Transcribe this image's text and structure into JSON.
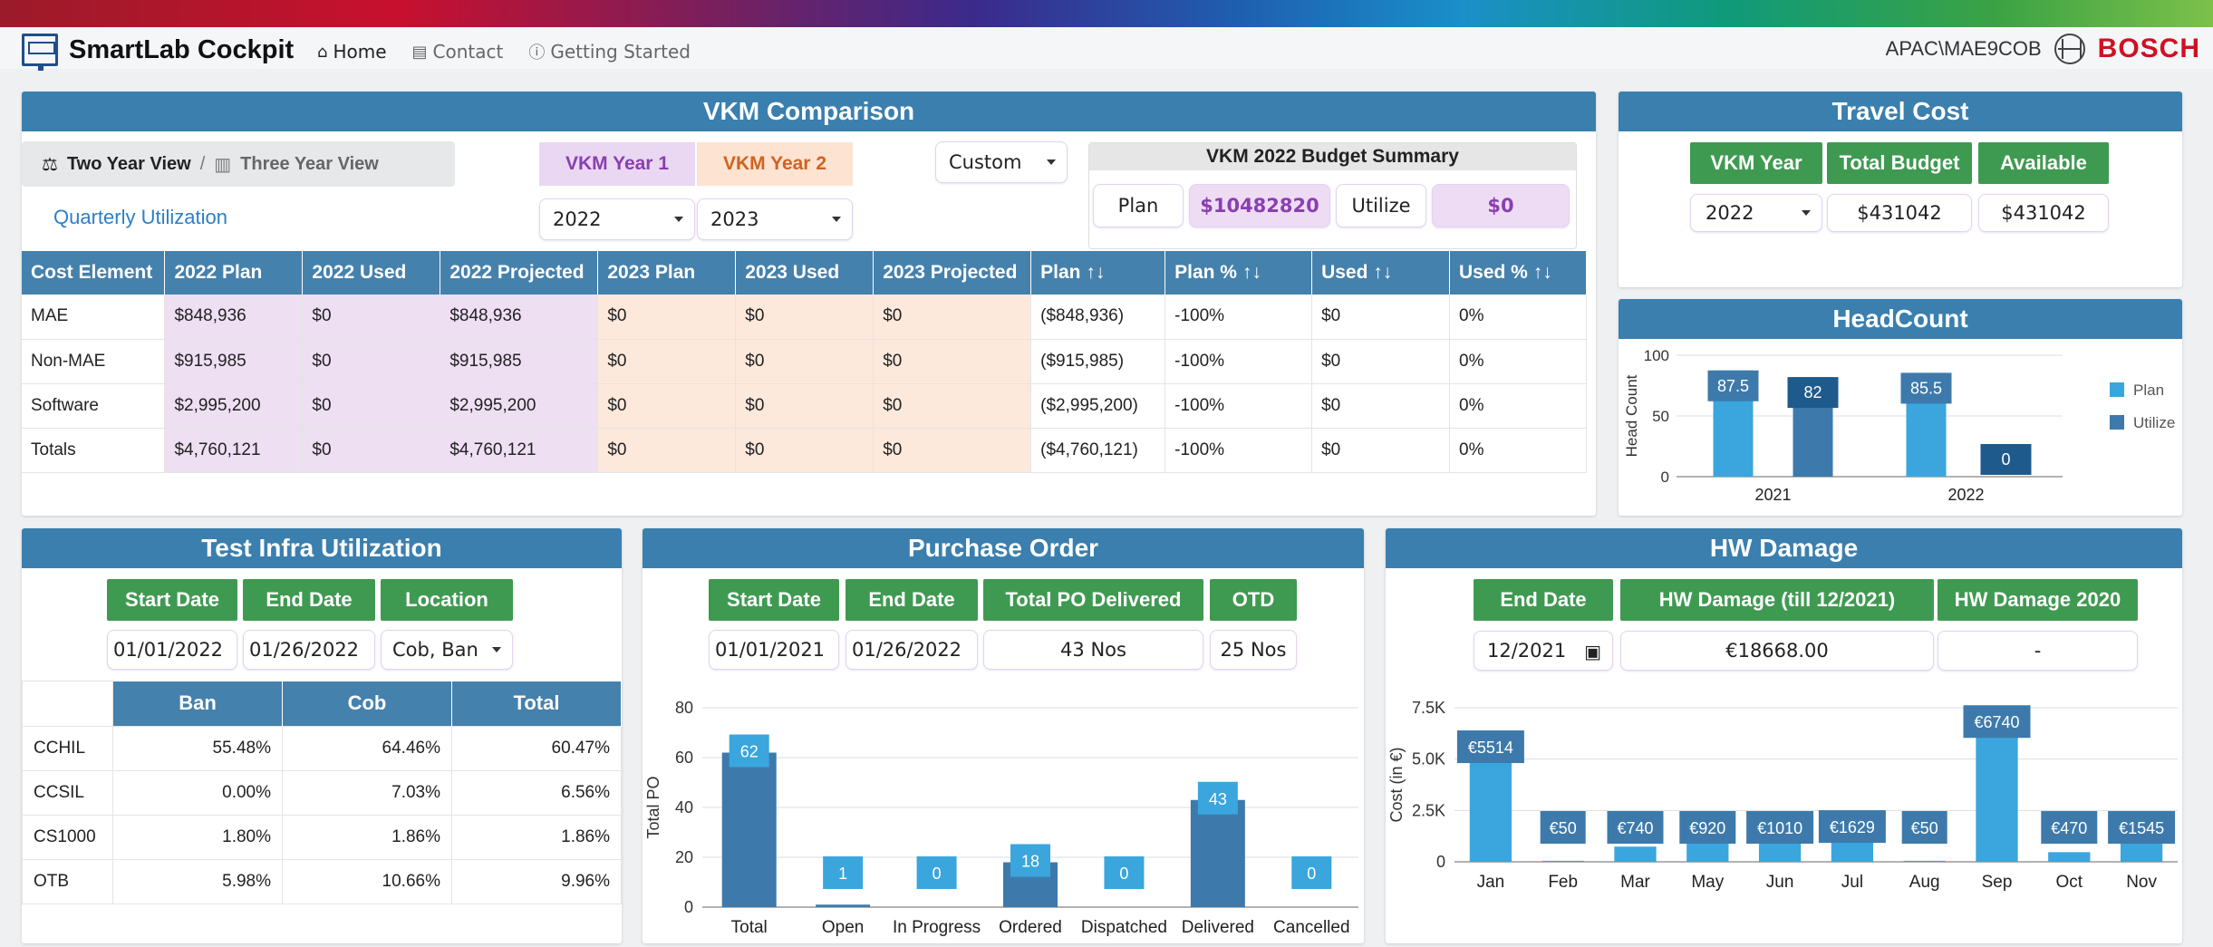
{
  "app": {
    "title": "SmartLab Cockpit",
    "user": "APAC\\MAE9COB",
    "company": "BOSCH"
  },
  "nav": [
    {
      "label": "Home",
      "icon": "home-icon"
    },
    {
      "label": "Contact",
      "icon": "contact-card-icon"
    },
    {
      "label": "Getting Started",
      "icon": "info-circle-icon"
    }
  ],
  "vkm": {
    "title": "VKM Comparison",
    "view_two": "Two Year View",
    "view_sep": "/",
    "view_three": "Three Year View",
    "quarterly_link": "Quarterly Utilization",
    "year1_label": "VKM Year 1",
    "year2_label": "VKM Year 2",
    "year1_value": "2022",
    "year2_value": "2023",
    "custom_value": "Custom",
    "budget": {
      "title": "VKM 2022 Budget Summary",
      "plan_label": "Plan",
      "plan_value": "$10482820",
      "utilize_label": "Utilize",
      "utilize_value": "$0"
    },
    "columns": [
      "Cost Element",
      "2022 Plan",
      "2022 Used",
      "2022 Projected",
      "2023 Plan",
      "2023 Used",
      "2023 Projected",
      "Plan ↑↓",
      "Plan % ↑↓",
      "Used ↑↓",
      "Used % ↑↓"
    ],
    "rows": [
      [
        "MAE",
        "$848,936",
        "$0",
        "$848,936",
        "$0",
        "$0",
        "$0",
        "($848,936)",
        "-100%",
        "$0",
        "0%"
      ],
      [
        "Non-MAE",
        "$915,985",
        "$0",
        "$915,985",
        "$0",
        "$0",
        "$0",
        "($915,985)",
        "-100%",
        "$0",
        "0%"
      ],
      [
        "Software",
        "$2,995,200",
        "$0",
        "$2,995,200",
        "$0",
        "$0",
        "$0",
        "($2,995,200)",
        "-100%",
        "$0",
        "0%"
      ],
      [
        "Totals",
        "$4,760,121",
        "$0",
        "$4,760,121",
        "$0",
        "$0",
        "$0",
        "($4,760,121)",
        "-100%",
        "$0",
        "0%"
      ]
    ]
  },
  "travel": {
    "title": "Travel Cost",
    "year_label": "VKM Year",
    "total_label": "Total Budget",
    "available_label": "Available",
    "year_value": "2022",
    "total_value": "$431042",
    "available_value": "$431042"
  },
  "headcount": {
    "title": "HeadCount",
    "chart_data": {
      "type": "bar",
      "ylabel": "Head Count",
      "ylim": [
        0,
        100
      ],
      "yticks": [
        "0",
        "50",
        "100"
      ],
      "categories": [
        "2021",
        "2022"
      ],
      "series": [
        {
          "name": "Plan",
          "values": [
            87.5,
            85.5
          ],
          "color": "#3aa6dd"
        },
        {
          "name": "Utilize",
          "values": [
            82,
            0
          ],
          "color": "#3d7aab"
        }
      ],
      "labels": [
        [
          "87.5",
          "85.5"
        ],
        [
          "82",
          "0"
        ]
      ],
      "legend": "right",
      "legend_labels": [
        "Plan",
        "Utilize"
      ]
    }
  },
  "test_infra": {
    "title": "Test Infra Utilization",
    "start_label": "Start Date",
    "end_label": "End Date",
    "location_label": "Location",
    "start_value": "01/01/2022",
    "end_value": "01/26/2022",
    "location_value": "Cob, Ban",
    "columns": [
      "Ban",
      "Cob",
      "Total"
    ],
    "rows": [
      [
        "CCHIL",
        "55.48%",
        "64.46%",
        "60.47%"
      ],
      [
        "CCSIL",
        "0.00%",
        "7.03%",
        "6.56%"
      ],
      [
        "CS1000",
        "1.80%",
        "1.86%",
        "1.86%"
      ],
      [
        "OTB",
        "5.98%",
        "10.66%",
        "9.96%"
      ]
    ]
  },
  "purchase": {
    "title": "Purchase Order",
    "start_label": "Start Date",
    "end_label": "End Date",
    "delivered_label": "Total PO Delivered",
    "otd_label": "OTD",
    "start_value": "01/01/2021",
    "end_value": "01/26/2022",
    "delivered_value": "43 Nos",
    "otd_value": "25 Nos",
    "chart_data": {
      "type": "bar",
      "ylabel": "Total PO",
      "ylim": [
        0,
        80
      ],
      "yticks": [
        "0",
        "20",
        "40",
        "60",
        "80"
      ],
      "categories": [
        "Total",
        "Open",
        "In Progress",
        "Ordered",
        "Dispatched",
        "Delivered",
        "Cancelled"
      ],
      "values": [
        62,
        1,
        0,
        18,
        0,
        43,
        0
      ],
      "labels": [
        "62",
        "1",
        "0",
        "18",
        "0",
        "43",
        "0"
      ],
      "bar_color": "#3d7aab",
      "label_color": "#3aa6dd"
    }
  },
  "hw": {
    "title": "HW Damage",
    "end_label": "End Date",
    "till_label": "HW Damage (till 12/2021)",
    "y2020_label": "HW Damage 2020",
    "end_value": "12/2021",
    "till_value": "€18668.00",
    "y2020_value": "-",
    "chart_data": {
      "type": "bar",
      "ylabel": "Cost (in €)",
      "ylim": [
        0,
        7500
      ],
      "yticks": [
        "0",
        "2.5K",
        "5.0K",
        "7.5K"
      ],
      "categories": [
        "Jan",
        "Feb",
        "Mar",
        "May",
        "Jun",
        "Jul",
        "Aug",
        "Sep",
        "Oct",
        "Nov"
      ],
      "values": [
        5514,
        50,
        740,
        920,
        1010,
        1629,
        50,
        6740,
        470,
        1545
      ],
      "labels": [
        "€5514",
        "€50",
        "€740",
        "€920",
        "€1010",
        "€1629",
        "€50",
        "€6740",
        "€470",
        "€1545"
      ],
      "bar_color": "#3aa6dd",
      "label_color": "#3d7aab"
    }
  }
}
